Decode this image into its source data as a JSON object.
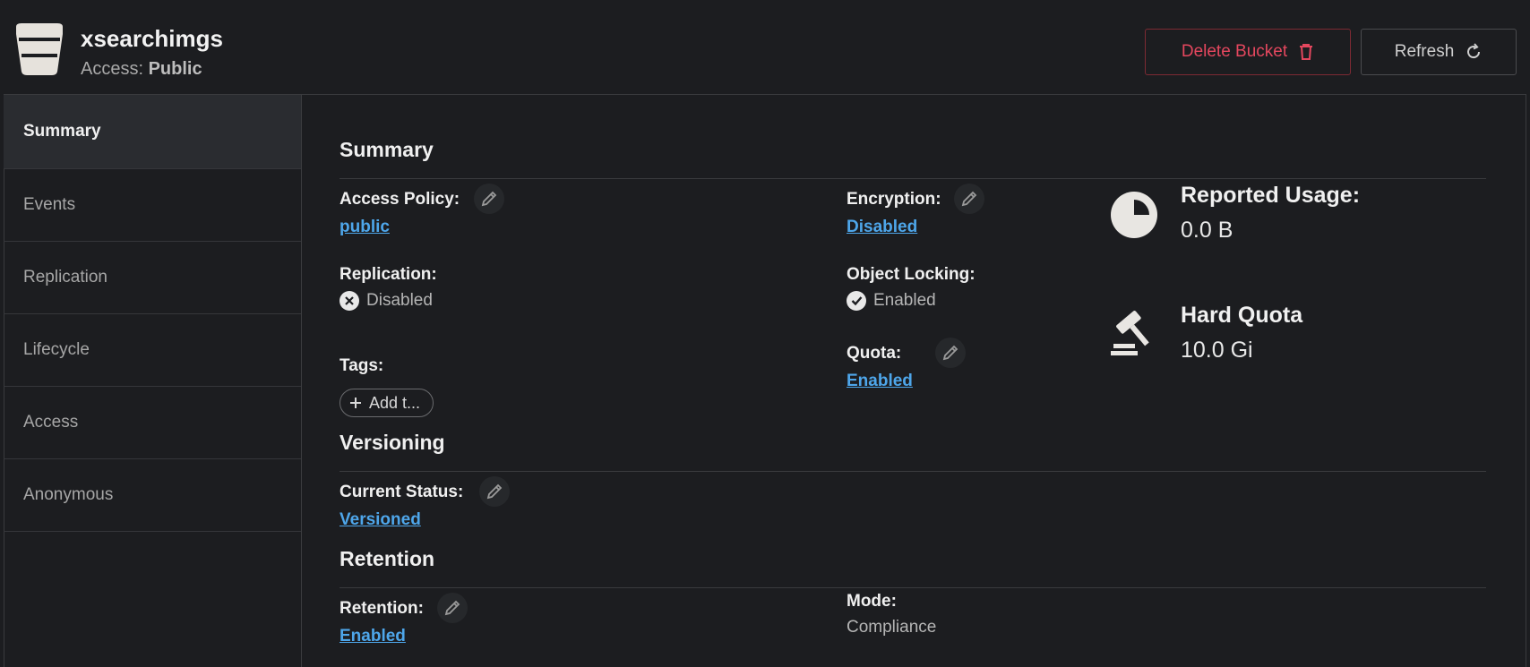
{
  "header": {
    "bucket_name": "xsearchimgs",
    "access_label": "Access:",
    "access_value": "Public",
    "delete_label": "Delete Bucket",
    "refresh_label": "Refresh"
  },
  "sidebar": {
    "items": [
      {
        "label": "Summary"
      },
      {
        "label": "Events"
      },
      {
        "label": "Replication"
      },
      {
        "label": "Lifecycle"
      },
      {
        "label": "Access"
      },
      {
        "label": "Anonymous"
      }
    ]
  },
  "summary": {
    "title": "Summary",
    "access_policy_label": "Access Policy:",
    "access_policy_value": "public",
    "encryption_label": "Encryption:",
    "encryption_value": "Disabled",
    "replication_label": "Replication:",
    "replication_value": "Disabled",
    "object_locking_label": "Object Locking:",
    "object_locking_value": "Enabled",
    "tags_label": "Tags:",
    "add_tag_label": "Add t...",
    "quota_label": "Quota:",
    "quota_value": "Enabled",
    "reported_usage_label": "Reported Usage:",
    "reported_usage_value": "0.0 B",
    "hard_quota_label": "Hard Quota",
    "hard_quota_value": "10.0 Gi"
  },
  "versioning": {
    "title": "Versioning",
    "current_status_label": "Current Status:",
    "current_status_value": "Versioned"
  },
  "retention": {
    "title": "Retention",
    "retention_label": "Retention:",
    "retention_value": "Enabled",
    "mode_label": "Mode:",
    "mode_value": "Compliance"
  },
  "colors": {
    "background": "#1c1d20",
    "link": "#4ea6ea",
    "danger": "#e4475e"
  }
}
